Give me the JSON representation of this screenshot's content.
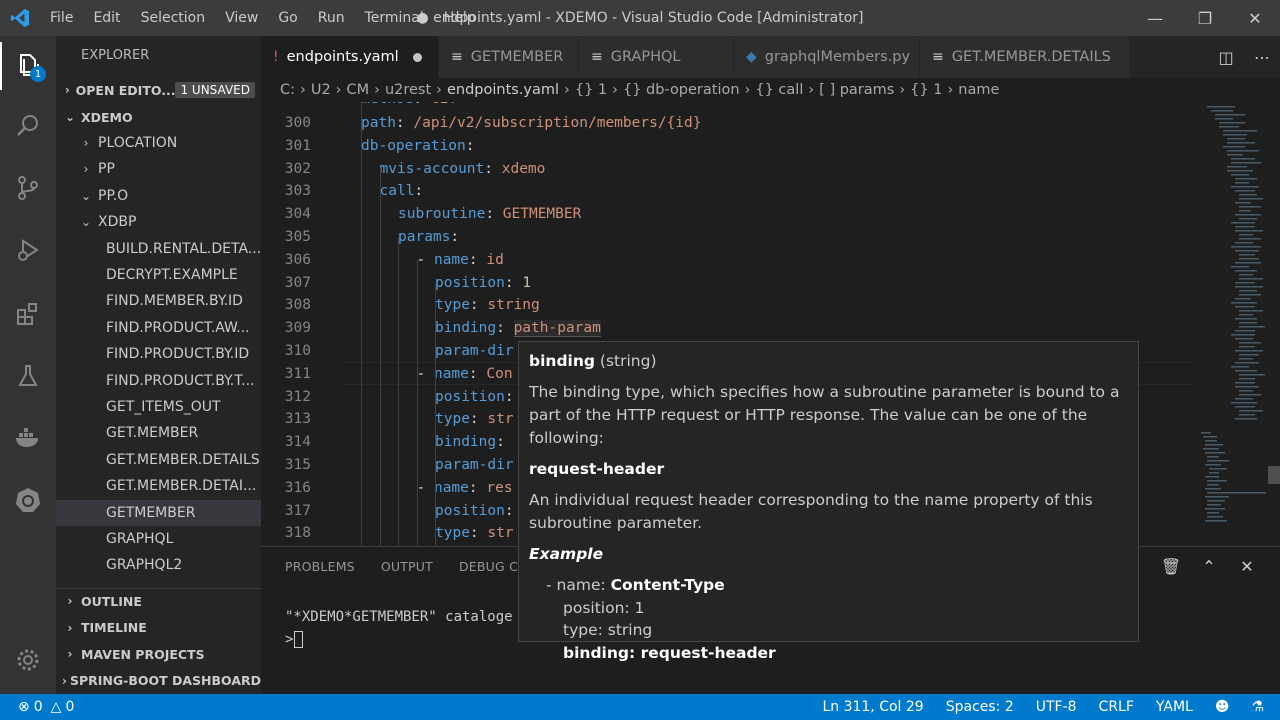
{
  "titlebar": {
    "menu": [
      "File",
      "Edit",
      "Selection",
      "View",
      "Go",
      "Run",
      "Terminal",
      "Help"
    ],
    "title": "● endpoints.yaml - XDEMO - Visual Studio Code [Administrator]"
  },
  "activitybar": {
    "explorer_badge": "1"
  },
  "sidebar": {
    "title": "EXPLORER",
    "open_editors": "OPEN EDITO...",
    "unsaved": "1 UNSAVED",
    "workspace": "XDEMO",
    "items": [
      {
        "label": "PLOCATION",
        "chev": "›",
        "indent": 1
      },
      {
        "label": "PP",
        "chev": "›",
        "indent": 1
      },
      {
        "label": "PP.O",
        "chev": "⌄",
        "indent": 1
      },
      {
        "label": "XDBP",
        "chev": "⌄",
        "indent": 1
      },
      {
        "label": "BUILD.RENTAL.DETA...",
        "indent": 2
      },
      {
        "label": "DECRYPT.EXAMPLE",
        "indent": 2
      },
      {
        "label": "FIND.MEMBER.BY.ID",
        "indent": 2
      },
      {
        "label": "FIND.PRODUCT.AW...",
        "indent": 2
      },
      {
        "label": "FIND.PRODUCT.BY.ID",
        "indent": 2
      },
      {
        "label": "FIND.PRODUCT.BY.T...",
        "indent": 2
      },
      {
        "label": "GET_ITEMS_OUT",
        "indent": 2
      },
      {
        "label": "GET.MEMBER",
        "indent": 2
      },
      {
        "label": "GET.MEMBER.DETAILS",
        "indent": 2
      },
      {
        "label": "GET.MEMBER.DETAI...",
        "indent": 2
      },
      {
        "label": "GETMEMBER",
        "indent": 2,
        "selected": true
      },
      {
        "label": "GRAPHQL",
        "indent": 2
      },
      {
        "label": "GRAPHQL2",
        "indent": 2
      }
    ],
    "sections": [
      "OUTLINE",
      "TIMELINE",
      "MAVEN PROJECTS",
      "SPRING-BOOT DASHBOARD"
    ]
  },
  "tabs": [
    {
      "label": "endpoints.yaml",
      "icon": "!",
      "active": true,
      "dirty": true
    },
    {
      "label": "GETMEMBER",
      "icon": "≡"
    },
    {
      "label": "GRAPHQL",
      "icon": "≡"
    },
    {
      "label": "graphqlMembers.py",
      "icon": "◆"
    },
    {
      "label": "GET.MEMBER.DETAILS",
      "icon": "≡"
    }
  ],
  "breadcrumb": [
    "C:",
    "U2",
    "CM",
    "u2rest",
    "endpoints.yaml",
    "{} 1",
    "{} db-operation",
    "{} call",
    "[ ] params",
    "{} 1",
    "name"
  ],
  "editor": {
    "lines": [
      {
        "num": "300",
        "indent": 0,
        "key": "path",
        "val": "/api/v2/subscription/members/{id}",
        "vtype": "v"
      },
      {
        "num": "301",
        "indent": 0,
        "key": "db-operation",
        "val": "",
        "vtype": "v"
      },
      {
        "num": "302",
        "indent": 1,
        "key": "mvis-account",
        "val": "xdemo",
        "vtype": "v"
      },
      {
        "num": "303",
        "indent": 1,
        "key": "call",
        "val": "",
        "vtype": "v"
      },
      {
        "num": "304",
        "indent": 2,
        "key": "subroutine",
        "val": "GETMEMBER",
        "vtype": "v"
      },
      {
        "num": "305",
        "indent": 2,
        "key": "params",
        "val": "",
        "vtype": "v"
      },
      {
        "num": "306",
        "indent": 3,
        "dash": true,
        "key": "name",
        "val": "id",
        "vtype": "v"
      },
      {
        "num": "307",
        "indent": 4,
        "key": "position",
        "val": "1",
        "vtype": "n"
      },
      {
        "num": "308",
        "indent": 4,
        "key": "type",
        "val": "string",
        "vtype": "v"
      },
      {
        "num": "309",
        "indent": 4,
        "key": "binding",
        "val": "path-param",
        "vtype": "v"
      },
      {
        "num": "310",
        "indent": 4,
        "key": "param-dir",
        "val": "",
        "vtype": "v",
        "nocolon": true
      },
      {
        "num": "311",
        "indent": 3,
        "dash": true,
        "key": "name",
        "val": "Con",
        "vtype": "v"
      },
      {
        "num": "312",
        "indent": 4,
        "key": "position",
        "val": "",
        "vtype": "v"
      },
      {
        "num": "313",
        "indent": 4,
        "key": "type",
        "val": "str",
        "vtype": "v"
      },
      {
        "num": "314",
        "indent": 4,
        "key": "binding",
        "val": "",
        "vtype": "v"
      },
      {
        "num": "315",
        "indent": 4,
        "key": "param-dir",
        "val": "",
        "vtype": "v",
        "nocolon": true
      },
      {
        "num": "316",
        "indent": 3,
        "dash": true,
        "key": "name",
        "val": "res",
        "vtype": "v"
      },
      {
        "num": "317",
        "indent": 4,
        "key": "position",
        "val": "",
        "vtype": "v"
      },
      {
        "num": "318",
        "indent": 4,
        "key": "type",
        "val": "str",
        "vtype": "v"
      }
    ]
  },
  "hover": {
    "title": "binding",
    "title_type": " (string)",
    "description": "The binding type, which specifies how a subroutine parameter is bound to a part of the HTTP request or HTTP response. The value can be one of the following:",
    "option": "request-header",
    "option_desc": "An individual request header corresponding to the name property of this subroutine parameter.",
    "example_label": "Example",
    "example_name_prefix": "-  name: ",
    "example_name": "Content-Type",
    "example_position": "position: 1",
    "example_type": "type: string",
    "example_binding": "binding: request-header"
  },
  "panel": {
    "tabs": [
      "PROBLEMS",
      "OUTPUT",
      "DEBUG CON"
    ],
    "terminal_line": "\"*XDEMO*GETMEMBER\" cataloge",
    "prompt": ">"
  },
  "statusbar": {
    "errors": "0",
    "warnings": "0",
    "position": "Ln 311, Col 29",
    "spaces": "Spaces: 2",
    "encoding": "UTF-8",
    "eol": "CRLF",
    "language": "YAML"
  },
  "colors": {
    "accent": "#007acc",
    "key": "#569cd6",
    "string": "#ce9178",
    "number": "#b5cea8"
  }
}
